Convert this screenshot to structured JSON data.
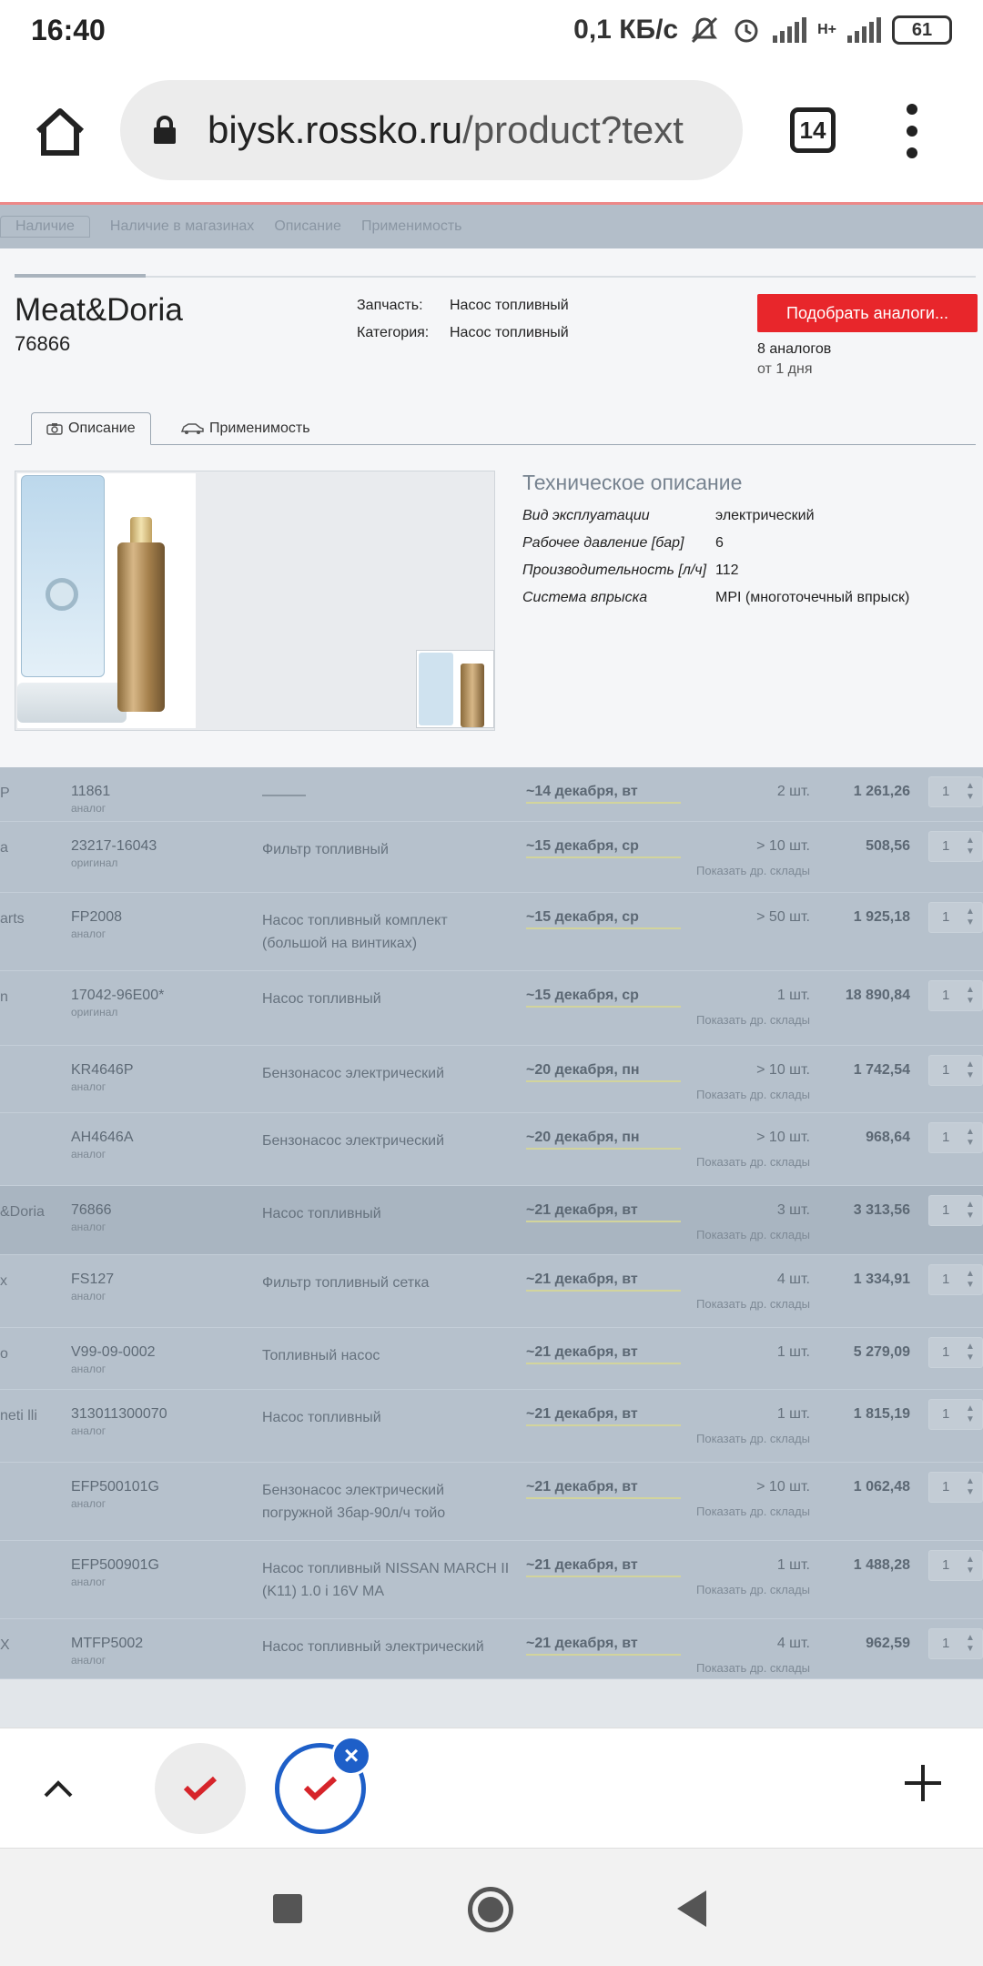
{
  "status": {
    "time": "16:40",
    "speed": "0,1 КБ/с",
    "battery": "61",
    "net": "H+"
  },
  "browser": {
    "url_host": "biysk.rossko.ru",
    "url_path": "/product?text",
    "tab_count": "14"
  },
  "bg_tabs": [
    "Наличие",
    "Наличие в магазинах",
    "Описание",
    "Применимость"
  ],
  "product": {
    "brand": "Meat&Doria",
    "sku": "76866",
    "part_label": "Запчасть:",
    "part_value": "Насос топливный",
    "category_label": "Категория:",
    "category_value": "Насос топливный",
    "find_analogs": "Подобрать аналоги...",
    "analogs_count": "8 аналогов",
    "analogs_from": "от 1 дня",
    "tab_description": "Описание",
    "tab_applicability": "Применимость"
  },
  "tech": {
    "title": "Техническое описание",
    "rows": [
      {
        "k": "Вид эксплуатации",
        "v": "электрический"
      },
      {
        "k": "Рабочее давление [бар]",
        "v": "6"
      },
      {
        "k": "Производительность [л/ч]",
        "v": "112"
      },
      {
        "k": "Система впрыска",
        "v": "MPI (многоточечный впрыск)"
      }
    ]
  },
  "table": {
    "more_stores": "Показать др. склады",
    "rows": [
      {
        "brand": "P",
        "code": "11861",
        "kind": "аналог",
        "name": "———",
        "date": "~14 декабря, вт",
        "stock": "2 шт.",
        "more": false,
        "price": "1 261,26",
        "qty": "1"
      },
      {
        "brand": "a",
        "code": "23217-16043",
        "kind": "оригинал",
        "name": "Фильтр топливный",
        "date": "~15 декабря, ср",
        "stock": "> 10 шт.",
        "more": true,
        "price": "508,56",
        "qty": "1"
      },
      {
        "brand": "arts",
        "code": "FP2008",
        "kind": "аналог",
        "name": "Насос топливный комплект (большой на винтиках)",
        "date": "~15 декабря, ср",
        "stock": "> 50 шт.",
        "more": false,
        "price": "1 925,18",
        "qty": "1"
      },
      {
        "brand": "n",
        "code": "17042-96E00*",
        "kind": "оригинал",
        "name": "Насос топливный",
        "date": "~15 декабря, ср",
        "stock": "1 шт.",
        "more": true,
        "price": "18 890,84",
        "qty": "1"
      },
      {
        "brand": "",
        "code": "KR4646P",
        "kind": "аналог",
        "name": "Бензонасос электрический",
        "date": "~20 декабря, пн",
        "stock": "> 10 шт.",
        "more": true,
        "price": "1 742,54",
        "qty": "1"
      },
      {
        "brand": "",
        "code": "AH4646A",
        "kind": "аналог",
        "name": "Бензонасос электрический",
        "date": "~20 декабря, пн",
        "stock": "> 10 шт.",
        "more": true,
        "price": "968,64",
        "qty": "1"
      },
      {
        "brand": "&Doria",
        "code": "76866",
        "kind": "аналог",
        "name": "Насос топливный",
        "date": "~21 декабря, вт",
        "stock": "3 шт.",
        "more": true,
        "price": "3 313,56",
        "qty": "1",
        "hl": true
      },
      {
        "brand": "x",
        "code": "FS127",
        "kind": "аналог",
        "name": "Фильтр топливный сетка",
        "date": "~21 декабря, вт",
        "stock": "4 шт.",
        "more": true,
        "price": "1 334,91",
        "qty": "1"
      },
      {
        "brand": "o",
        "code": "V99-09-0002",
        "kind": "аналог",
        "name": "Топливный насос",
        "date": "~21 декабря, вт",
        "stock": "1 шт.",
        "more": false,
        "price": "5 279,09",
        "qty": "1"
      },
      {
        "brand": "neti lli",
        "code": "313011300070",
        "kind": "аналог",
        "name": "Насос топливный",
        "date": "~21 декабря, вт",
        "stock": "1 шт.",
        "more": true,
        "price": "1 815,19",
        "qty": "1"
      },
      {
        "brand": "",
        "code": "EFP500101G",
        "kind": "аналог",
        "name": "Бензонасос электрический погружной 3бар-90л/ч тойо",
        "date": "~21 декабря, вт",
        "stock": "> 10 шт.",
        "more": true,
        "price": "1 062,48",
        "qty": "1"
      },
      {
        "brand": "",
        "code": "EFP500901G",
        "kind": "аналог",
        "name": "Насос топливный NISSAN MARCH II (K11) 1.0 i 16V MA",
        "date": "~21 декабря, вт",
        "stock": "1 шт.",
        "more": true,
        "price": "1 488,28",
        "qty": "1"
      },
      {
        "brand": "X",
        "code": "MTFP5002",
        "kind": "аналог",
        "name": "Насос топливный электрический",
        "date": "~21 декабря, вт",
        "stock": "4 шт.",
        "more": true,
        "price": "962,59",
        "qty": "1"
      }
    ]
  }
}
